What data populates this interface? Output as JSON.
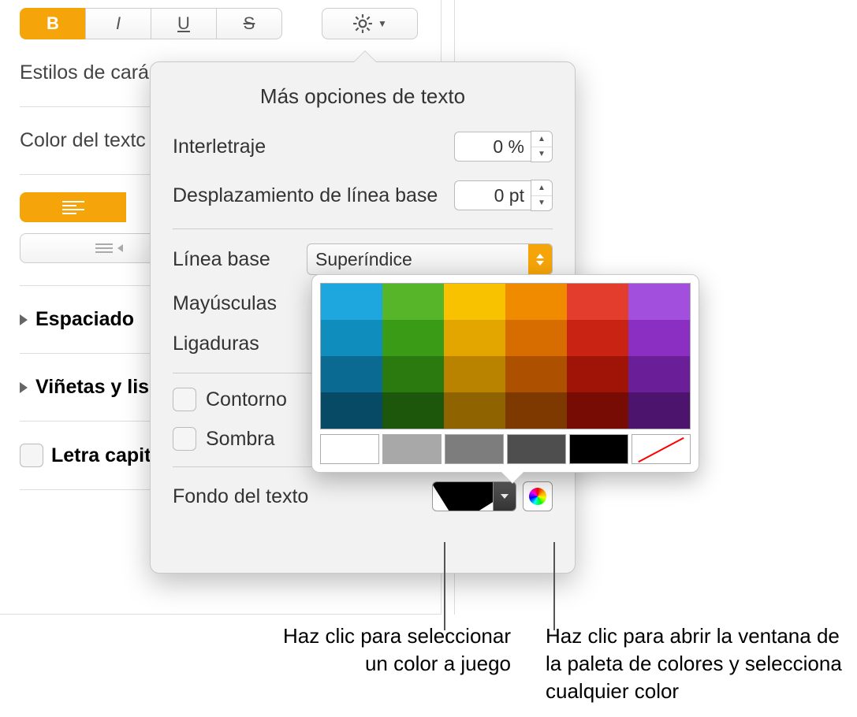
{
  "sidebar": {
    "char_styles": "Estilos de cará",
    "text_color": "Color del textc",
    "spacing": "Espaciado",
    "bullets": "Viñetas y lis",
    "dropcap": "Letra capit"
  },
  "popover": {
    "title": "Más opciones de texto",
    "tracking_label": "Interletraje",
    "tracking_value": "0 %",
    "baseline_shift_label": "Desplazamiento de línea base",
    "baseline_shift_value": "0 pt",
    "baseline_label": "Línea base",
    "baseline_select": "Superíndice",
    "caps_label": "Mayúsculas",
    "ligatures_label": "Ligaduras",
    "outline": "Contorno",
    "shadow": "Sombra",
    "text_bg": "Fondo del texto"
  },
  "colors": {
    "grid": [
      [
        "#1ea7df",
        "#57b52a",
        "#f9c200",
        "#f08b00",
        "#e33d2e",
        "#a24fdd"
      ],
      [
        "#0f8dbd",
        "#3a9b17",
        "#e3a500",
        "#d76d00",
        "#c92314",
        "#8a2fc1"
      ],
      [
        "#0a6a91",
        "#2a7a10",
        "#b98300",
        "#ad5100",
        "#a01407",
        "#6a1e98"
      ],
      [
        "#064a66",
        "#1d570b",
        "#8f6400",
        "#7e3900",
        "#760c03",
        "#4c146d"
      ]
    ],
    "gray": [
      "#ffffff",
      "#a8a8a8",
      "#7d7d7d",
      "#4e4e4e",
      "#000000",
      "slash"
    ]
  },
  "callouts": {
    "left": "Haz clic para seleccionar un color a juego",
    "right": "Haz clic para abrir la ventana de la paleta de colores y selecciona cualquier color"
  }
}
